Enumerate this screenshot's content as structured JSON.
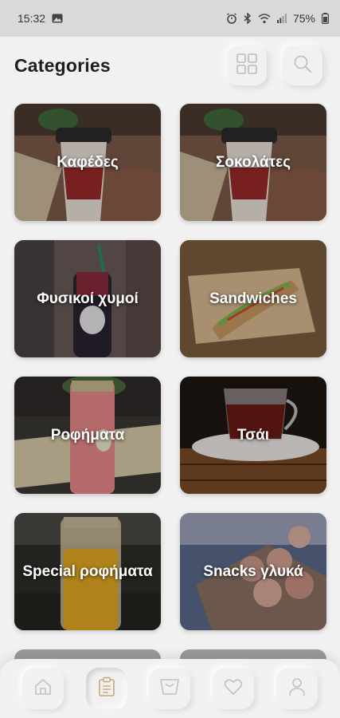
{
  "status_bar": {
    "time": "15:32",
    "battery": "75%",
    "icons": [
      "image-icon",
      "alarm-icon",
      "bluetooth-icon",
      "wifi-icon",
      "signal-icon",
      "battery-icon"
    ]
  },
  "header": {
    "title": "Categories",
    "actions": [
      "grid-view-icon",
      "search-icon"
    ]
  },
  "categories": [
    {
      "label": "Καφέδες",
      "image": "coffee-cup-photo",
      "tone": "#6b5040"
    },
    {
      "label": "Σοκολάτες",
      "image": "coffee-cup-photo",
      "tone": "#6b5040"
    },
    {
      "label": "Φυσικοί χυμοί",
      "image": "juice-bottle-photo",
      "tone": "#5a3b3b"
    },
    {
      "label": "Sandwiches",
      "image": "sandwich-photo",
      "tone": "#8a6a48"
    },
    {
      "label": "Ροφήματα",
      "image": "pink-drink-photo",
      "tone": "#4a4038"
    },
    {
      "label": "Τσάι",
      "image": "tea-cup-photo",
      "tone": "#3a2a20"
    },
    {
      "label": "Special ροφήματα",
      "image": "orange-drink-photo",
      "tone": "#3e3a34"
    },
    {
      "label": "Snacks γλυκά",
      "image": "pastry-photo",
      "tone": "#7a6a66"
    }
  ],
  "bottom_nav": {
    "active": "menu",
    "items": [
      "home-icon",
      "menu-icon",
      "cart-icon",
      "favorites-icon",
      "profile-icon"
    ]
  },
  "colors": {
    "background": "#f1f1f1",
    "status_bar": "#d9d9d9",
    "active_nav": "#c9a77a"
  }
}
